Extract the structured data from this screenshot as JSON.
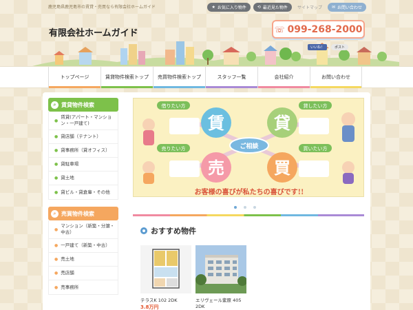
{
  "tagline": "鹿児島県鹿児島市の賃貸・売買なら有限会社ホームガイド",
  "topnav": {
    "favorites": "お気に入り物件",
    "recent": "最近見た物件",
    "sitemap": "サイトマップ",
    "contact": "お問い合わせ"
  },
  "header": {
    "company": "有限会社ホームガイド",
    "phone": "099-268-2000",
    "facebook": "いいね！",
    "twitter": "ポスト"
  },
  "nav": [
    {
      "label": "トップページ",
      "color": "#f5a75f"
    },
    {
      "label": "賃貸物件検索トップ",
      "color": "#7dc14a"
    },
    {
      "label": "売買物件検索トップ",
      "color": "#6fb8e0"
    },
    {
      "label": "スタッフ一覧",
      "color": "#a98ad6"
    },
    {
      "label": "会社紹介",
      "color": "#f08aa0"
    },
    {
      "label": "お問い合わせ",
      "color": "#f5d85f"
    }
  ],
  "sidebar": {
    "rent": {
      "title": "賃貸物件検索",
      "items": [
        "賃貸(アパート・マンション・一戸建て)",
        "貸店舗（テナント）",
        "貸事務所（貸オフィス）",
        "貸駐車場",
        "貸土地",
        "貸ビル・貸倉庫・その他"
      ]
    },
    "sale": {
      "title": "売買物件検索",
      "items": [
        "マンション（新築・分譲・中古）",
        "一戸建て（新築・中古）",
        "売土地",
        "売店舗",
        "売事務所"
      ]
    }
  },
  "banner": {
    "want_rent": "借りたい方",
    "want_lend": "貸したい方",
    "want_sell": "売りたい方",
    "want_buy": "買いたい方",
    "kanji_rent1": "賃",
    "kanji_rent2": "貸",
    "kanji_sell": "売",
    "kanji_buy": "買",
    "consult": "ご相談",
    "slogan": "お客様の喜びが私たちの喜びです!!"
  },
  "recommend": {
    "title": "おすすめ物件",
    "cards": [
      {
        "name": "テラスK 102 2DK",
        "price": "3.8万円"
      },
      {
        "name": "エリヴェール紫原 405 2DK",
        "price": ""
      }
    ]
  }
}
